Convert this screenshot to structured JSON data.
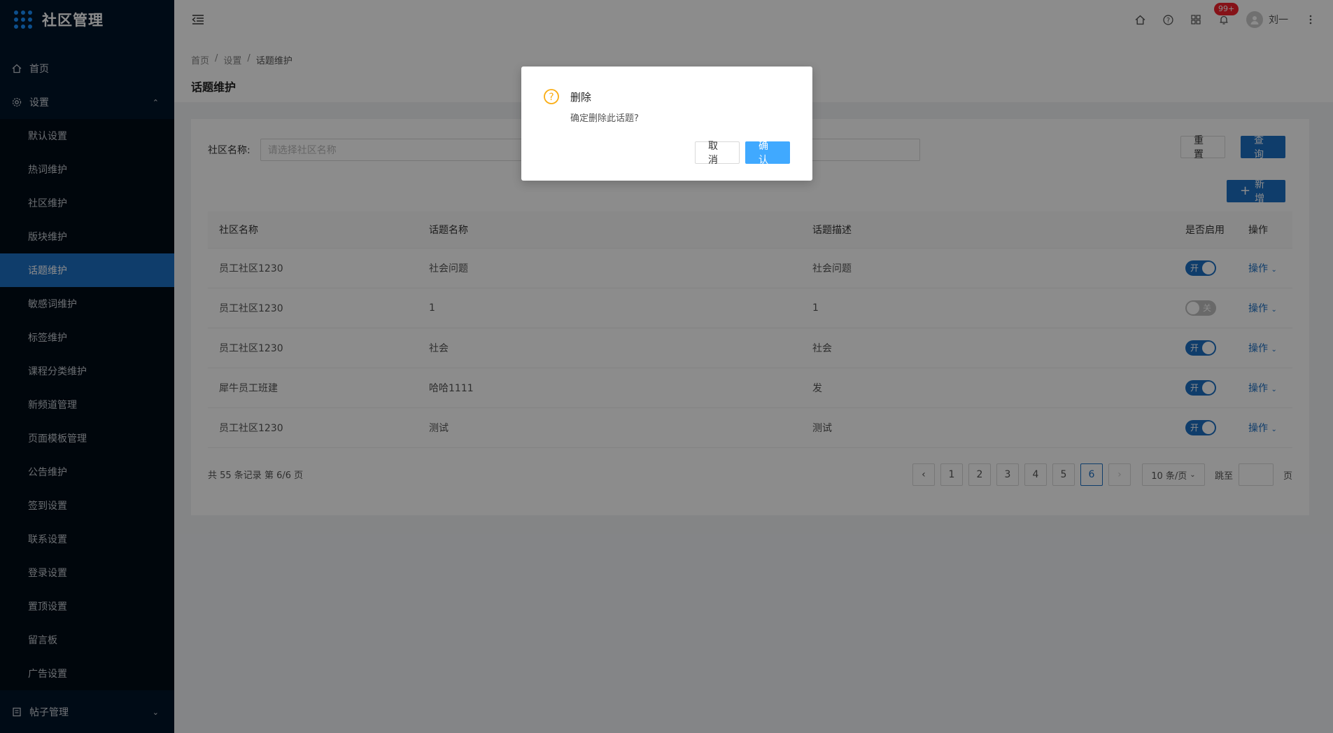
{
  "app": {
    "title": "社区管理"
  },
  "sidebar": {
    "home": "首页",
    "settings": "设置",
    "settings_items": [
      "默认设置",
      "热词维护",
      "社区维护",
      "版块维护",
      "话题维护",
      "敏感词维护",
      "标签维护",
      "课程分类维护",
      "新频道管理",
      "页面模板管理",
      "公告维护",
      "签到设置",
      "联系设置",
      "登录设置",
      "置顶设置",
      "留言板",
      "广告设置"
    ],
    "active_index": 4,
    "posts": "帖子管理"
  },
  "header": {
    "badge": "99+",
    "user_name": "刘一"
  },
  "breadcrumb": {
    "items": [
      "首页",
      "设置",
      "话题维护"
    ],
    "sep": "/"
  },
  "page": {
    "title": "话题维护"
  },
  "search": {
    "label": "社区名称:",
    "placeholder": "请选择社区名称",
    "reset": "重 置",
    "query": "查 询",
    "add": "新增"
  },
  "table": {
    "headers": [
      "社区名称",
      "话题名称",
      "话题描述",
      "是否启用",
      "操作"
    ],
    "rows": [
      {
        "community": "员工社区1230",
        "topic": "社会问题",
        "desc": "社会问题",
        "enabled": true,
        "switch_text": "开",
        "op": "操作"
      },
      {
        "community": "员工社区1230",
        "topic": "1",
        "desc": "1",
        "enabled": false,
        "switch_text": "关",
        "op": "操作"
      },
      {
        "community": "员工社区1230",
        "topic": "社会",
        "desc": "社会",
        "enabled": true,
        "switch_text": "开",
        "op": "操作"
      },
      {
        "community": "犀牛员工班建",
        "topic": "哈哈1111",
        "desc": "发",
        "enabled": true,
        "switch_text": "开",
        "op": "操作"
      },
      {
        "community": "员工社区1230",
        "topic": "测试",
        "desc": "测试",
        "enabled": true,
        "switch_text": "开",
        "op": "操作"
      }
    ]
  },
  "pagination": {
    "total_text": "共 55 条记录 第 6/6 页",
    "pages": [
      "1",
      "2",
      "3",
      "4",
      "5",
      "6"
    ],
    "current": "6",
    "page_size": "10 条/页",
    "jump_label": "跳至",
    "page_unit": "页"
  },
  "modal": {
    "title": "删除",
    "content": "确定删除此话题?",
    "cancel": "取 消",
    "ok": "确 认"
  },
  "colors": {
    "primary": "#1c6fc4",
    "sidebar_bg": "#001529",
    "warning": "#faad14"
  }
}
